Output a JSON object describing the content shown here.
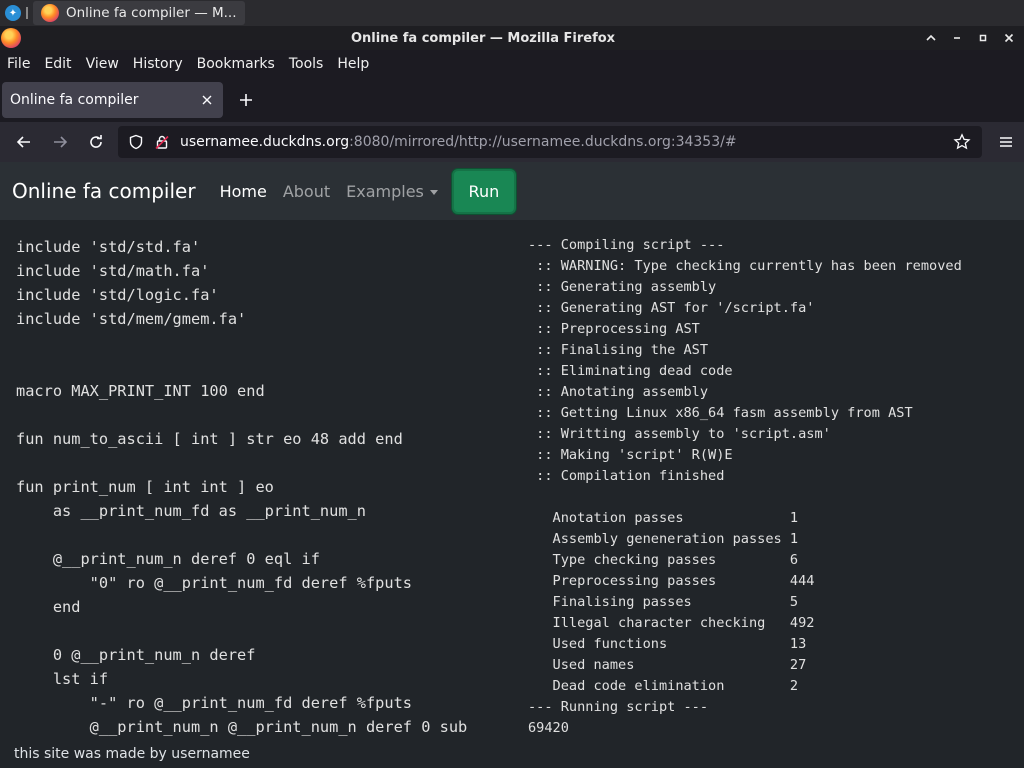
{
  "taskbar": {
    "window_title": "Online fa compiler — M..."
  },
  "window": {
    "title": "Online fa compiler — Mozilla Firefox",
    "controls": [
      "^",
      "_",
      "▫",
      "✕"
    ]
  },
  "menubar": {
    "items": [
      {
        "label": "File"
      },
      {
        "label": "Edit"
      },
      {
        "label": "View"
      },
      {
        "label": "History"
      },
      {
        "label": "Bookmarks"
      },
      {
        "label": "Tools"
      },
      {
        "label": "Help"
      }
    ]
  },
  "tabs": [
    {
      "label": "Online fa compiler",
      "active": true
    }
  ],
  "navbar": {
    "url_host": "usernamee.duckdns.org",
    "url_rest": ":8080/mirrored/http://usernamee.duckdns.org:34353/#"
  },
  "site": {
    "brand": "Online fa compiler",
    "nav": [
      {
        "label": "Home",
        "active": true
      },
      {
        "label": "About",
        "active": false
      },
      {
        "label": "Examples",
        "active": false
      }
    ],
    "run_label": "Run",
    "footer": "this site was made by usernamee"
  },
  "editor": {
    "code": "include 'std/std.fa'\ninclude 'std/math.fa'\ninclude 'std/logic.fa'\ninclude 'std/mem/gmem.fa'\n\n\nmacro MAX_PRINT_INT 100 end\n\nfun num_to_ascii [ int ] str eo 48 add end\n\nfun print_num [ int int ] eo\n    as __print_num_fd as __print_num_n\n\n    @__print_num_n deref 0 eql if\n        \"0\" ro @__print_num_fd deref %fputs\n    end\n\n    0 @__print_num_n deref\n    lst if\n        \"-\" ro @__print_num_fd deref %fputs\n        @__print_num_n @__print_num_n deref 0 sub"
  },
  "output": {
    "text": "--- Compiling script ---\n :: WARNING: Type checking currently has been removed\n :: Generating assembly\n :: Generating AST for '/script.fa'\n :: Preprocessing AST\n :: Finalising the AST\n :: Eliminating dead code\n :: Anotating assembly\n :: Getting Linux x86_64 fasm assembly from AST\n :: Writting assembly to 'script.asm'\n :: Making 'script' R(W)E\n :: Compilation finished\n\n   Anotation passes             1\n   Assembly geneneration passes 1\n   Type checking passes         6\n   Preprocessing passes         444\n   Finalising passes            5\n   Illegal character checking   492\n   Used functions               13\n   Used names                   27\n   Dead code elimination        2\n--- Running script ---\n69420"
  }
}
